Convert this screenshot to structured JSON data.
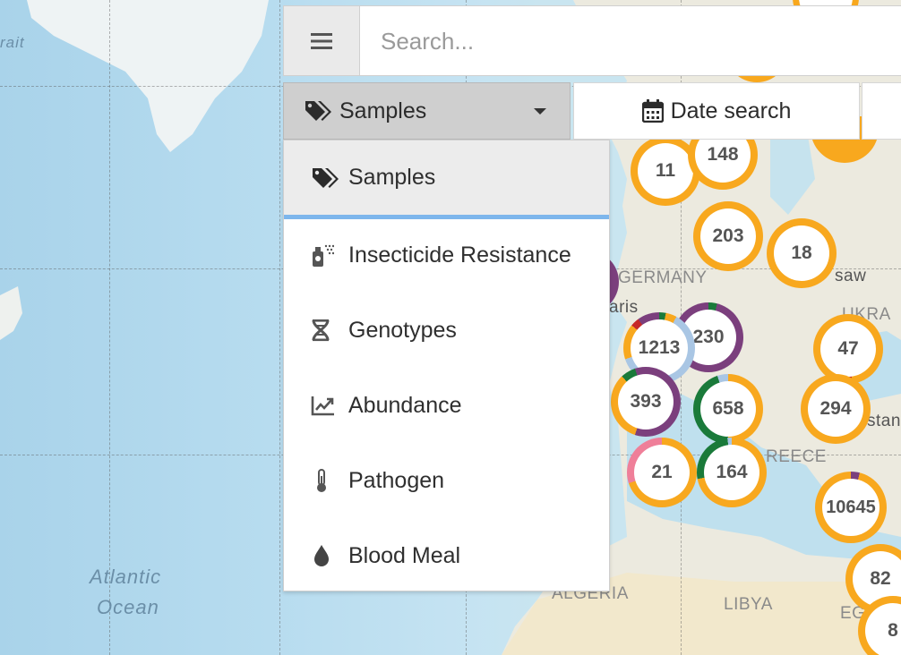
{
  "toolbar": {
    "menu_icon": "hamburger-icon",
    "search_placeholder": "Search...",
    "view_select_label": "Samples",
    "date_search_label": "Date search"
  },
  "dropdown": {
    "items": [
      {
        "label": "Samples",
        "icon": "tags-icon",
        "active": true
      },
      {
        "label": "Insecticide Resistance",
        "icon": "spray-can-icon",
        "active": false
      },
      {
        "label": "Genotypes",
        "icon": "dna-icon",
        "active": false
      },
      {
        "label": "Abundance",
        "icon": "chart-line-icon",
        "active": false
      },
      {
        "label": "Pathogen",
        "icon": "thermometer-icon",
        "active": false
      },
      {
        "label": "Blood Meal",
        "icon": "tint-icon",
        "active": false
      }
    ]
  },
  "map": {
    "labels": {
      "ocean_line1": "Atlantic",
      "ocean_line2": "Ocean",
      "strait": "rait",
      "germany": "GERMANY",
      "paris": "aris",
      "warsaw": "saw",
      "ukraine": "UKRA",
      "greece": "REECE",
      "algeria": "ALGERIA",
      "libya": "LIBYA",
      "egypt": "EG",
      "istanbul": "stan"
    },
    "clusters": [
      {
        "count": "11"
      },
      {
        "count": "148"
      },
      {
        "count": "203"
      },
      {
        "count": "18"
      },
      {
        "count": "1213"
      },
      {
        "count": "230"
      },
      {
        "count": "47"
      },
      {
        "count": "393"
      },
      {
        "count": "658"
      },
      {
        "count": "294"
      },
      {
        "count": "21"
      },
      {
        "count": "164"
      },
      {
        "count": "10645"
      },
      {
        "count": "82"
      },
      {
        "count": "8"
      }
    ],
    "colors": {
      "cluster_ring": "#f8a81e",
      "purple": "#7b3f7d",
      "green": "#1a7a3a",
      "lightblue": "#a9c6e4",
      "pink": "#ef7f99",
      "red": "#c62828",
      "dropdown_active_border": "#7db6ec"
    }
  }
}
